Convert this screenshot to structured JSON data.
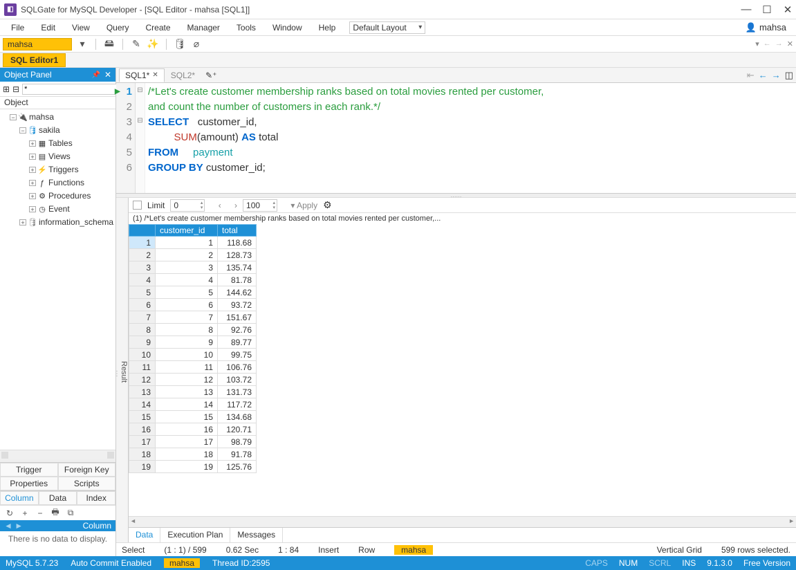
{
  "title": "SQLGate for MySQL Developer - [SQL Editor - mahsa [SQL1]]",
  "menu": [
    "File",
    "Edit",
    "View",
    "Query",
    "Create",
    "Manager",
    "Tools",
    "Window",
    "Help"
  ],
  "layout_select": "Default Layout",
  "user": "mahsa",
  "db_combo": "mahsa",
  "editor_tab": "SQL Editor1",
  "object_panel": {
    "title": "Object Panel",
    "filter_placeholder": "*",
    "object_label": "Object",
    "tree": {
      "root": "mahsa",
      "db": "sakila",
      "children": [
        "Tables",
        "Views",
        "Triggers",
        "Functions",
        "Procedures",
        "Event"
      ],
      "other_db": "information_schema"
    },
    "prop_buttons": [
      "Trigger",
      "Foreign Key",
      "Properties",
      "Scripts",
      "Column",
      "Data",
      "Index"
    ],
    "col_header": "Column",
    "no_data": "There is no data to display."
  },
  "sql_tabs": {
    "active": "SQL1*",
    "inactive": "SQL2*"
  },
  "code": {
    "l1": "/*Let's create customer membership ranks based on total movies rented per customer,",
    "l2": "and count the number of customers in each rank.*/",
    "l3a": "SELECT",
    "l3b": "customer_id,",
    "l4a": "SUM",
    "l4b": "(amount)",
    "l4c": "AS",
    "l4d": "total",
    "l5a": "FROM",
    "l5b": "payment",
    "l6a": "GROUP BY",
    "l6b": "customer_id",
    "l6c": ";"
  },
  "result": {
    "side_label": "Result",
    "limit_label": "Limit",
    "limit_val": "0",
    "page_val": "100",
    "apply": "Apply",
    "query_text": "(1) /*Let's create customer membership ranks based on total movies rented per customer,...",
    "columns": [
      "customer_id",
      "total"
    ],
    "rows": [
      [
        "1",
        "1",
        "118.68"
      ],
      [
        "2",
        "2",
        "128.73"
      ],
      [
        "3",
        "3",
        "135.74"
      ],
      [
        "4",
        "4",
        "81.78"
      ],
      [
        "5",
        "5",
        "144.62"
      ],
      [
        "6",
        "6",
        "93.72"
      ],
      [
        "7",
        "7",
        "151.67"
      ],
      [
        "8",
        "8",
        "92.76"
      ],
      [
        "9",
        "9",
        "89.77"
      ],
      [
        "10",
        "10",
        "99.75"
      ],
      [
        "11",
        "11",
        "106.76"
      ],
      [
        "12",
        "12",
        "103.72"
      ],
      [
        "13",
        "13",
        "131.73"
      ],
      [
        "14",
        "14",
        "117.72"
      ],
      [
        "15",
        "15",
        "134.68"
      ],
      [
        "16",
        "16",
        "120.71"
      ],
      [
        "17",
        "17",
        "98.79"
      ],
      [
        "18",
        "18",
        "91.78"
      ],
      [
        "19",
        "19",
        "125.76"
      ]
    ],
    "tabs": [
      "Data",
      "Execution Plan",
      "Messages"
    ]
  },
  "status": {
    "select": "Select",
    "pos": "(1 : 1) / 599",
    "time": "0.62 Sec",
    "ratio": "1 : 84",
    "insert": "Insert",
    "row": "Row",
    "db": "mahsa",
    "vgrid": "Vertical Grid",
    "sel": "599 rows selected."
  },
  "footer": {
    "server": "MySQL 5.7.23",
    "commit": "Auto Commit Enabled",
    "user": "mahsa",
    "thread": "Thread ID:2595",
    "caps": "CAPS",
    "num": "NUM",
    "scrl": "SCRL",
    "ins": "INS",
    "ver": "9.1.3.0",
    "edition": "Free Version"
  }
}
